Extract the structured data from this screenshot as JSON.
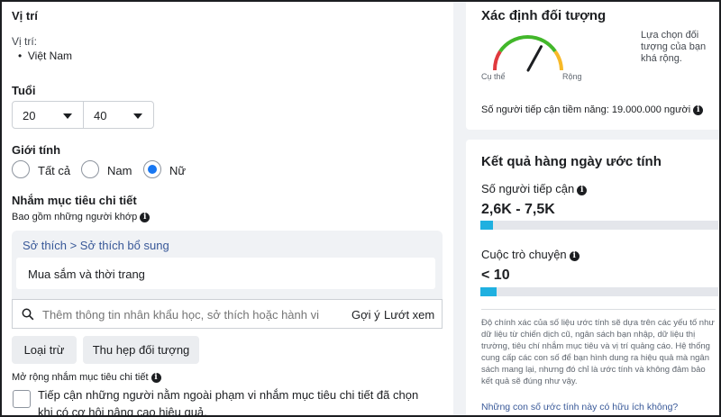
{
  "location": {
    "title": "Vị trí",
    "label": "Vị trí:",
    "items": [
      "Việt Nam"
    ]
  },
  "age": {
    "title": "Tuổi",
    "min": "20",
    "max": "40"
  },
  "gender": {
    "title": "Giới tính",
    "options": [
      "Tất cả",
      "Nam",
      "Nữ"
    ],
    "selected": "Nữ"
  },
  "detailed": {
    "title": "Nhắm mục tiêu chi tiết",
    "include_label": "Bao gồm những người khớp",
    "breadcrumb": "Sở thích > Sở thích bổ sung",
    "selected_item": "Mua sắm và thời trang",
    "search_placeholder": "Thêm thông tin nhân khẩu học, sở thích hoặc hành vi",
    "suggest_label": "Gợi ý",
    "browse_label": "Lướt xem",
    "exclude_button": "Loại trừ",
    "narrow_button": "Thu hẹp đối tượng"
  },
  "expansion": {
    "title": "Mở rộng nhắm mục tiêu chi tiết",
    "checkbox_label": "Tiếp cận những người nằm ngoài phạm vi nhắm mục tiêu chi tiết đã chọn khi có cơ hội nâng cao hiệu quả."
  },
  "audience_definition": {
    "title": "Xác định đối tượng",
    "gauge_left": "Cụ thể",
    "gauge_right": "Rộng",
    "description": "Lựa chọn đối tượng của bạn khá rộng.",
    "potential_reach": "Số người tiếp cận tiềm năng: 19.000.000 người",
    "gauge_level": 0.66
  },
  "daily_results": {
    "title": "Kết quả hàng ngày ước tính",
    "reach_label": "Số người tiếp cận",
    "reach_value": "2,6K - 7,5K",
    "reach_fraction": 0.05,
    "conv_label": "Cuộc trò chuyện",
    "conv_value": "< 10",
    "conv_fraction": 0.07,
    "disclaimer": "Độ chính xác của số liệu ước tính sẽ dựa trên các yếu tố như dữ liệu từ chiến dịch cũ, ngân sách bạn nhập, dữ liệu thị trường, tiêu chí nhắm mục tiêu và vị trí quảng cáo. Hệ thống cung cấp các con số để bạn hình dung ra hiệu quả mà ngân sách mang lại, nhưng đó chỉ là ước tính và không đảm bảo kết quả sẽ đúng như vậy.",
    "feedback_link": "Những con số ước tính này có hữu ích không?"
  },
  "colors": {
    "accent": "#1877f2",
    "bar_fill": "#1fb0e0",
    "gauge_red": "#e0393e",
    "gauge_green": "#42b72a",
    "gauge_orange": "#f7b928",
    "link": "#385898"
  }
}
